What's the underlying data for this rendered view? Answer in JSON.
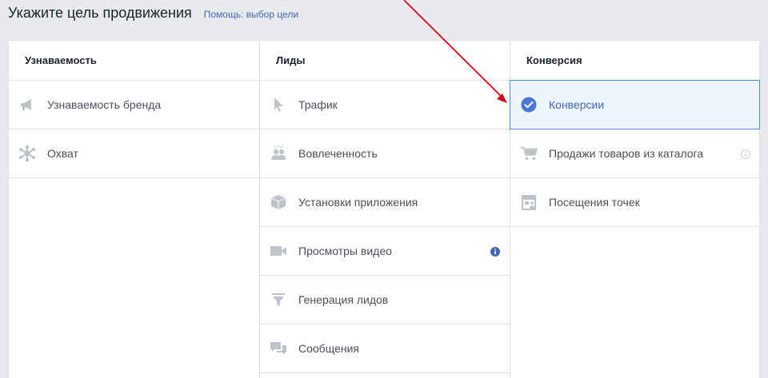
{
  "header": {
    "title": "Укажите цель продвижения",
    "help_link": "Помощь: выбор цели"
  },
  "columns": [
    {
      "heading": "Узнаваемость",
      "items": [
        {
          "label": "Узнаваемость бренда",
          "icon": "megaphone-icon"
        },
        {
          "label": "Охват",
          "icon": "reach-icon"
        }
      ]
    },
    {
      "heading": "Лиды",
      "items": [
        {
          "label": "Трафик",
          "icon": "cursor-icon"
        },
        {
          "label": "Вовлеченность",
          "icon": "people-icon"
        },
        {
          "label": "Установки приложения",
          "icon": "box-icon"
        },
        {
          "label": "Просмотры видео",
          "icon": "video-camera-icon",
          "info": true
        },
        {
          "label": "Генерация лидов",
          "icon": "funnel-icon"
        },
        {
          "label": "Сообщения",
          "icon": "chat-bubbles-icon"
        }
      ]
    },
    {
      "heading": "Конверсия",
      "items": [
        {
          "label": "Конверсии",
          "icon": "check-circle-icon",
          "selected": true
        },
        {
          "label": "Продажи товаров из каталога",
          "icon": "cart-icon",
          "info": true
        },
        {
          "label": "Посещения точек",
          "icon": "storefront-icon"
        }
      ]
    }
  ],
  "colors": {
    "background": "#e9eaed",
    "link": "#4267b2",
    "selected_border": "#4a90e2",
    "selected_bg": "#eef4fd",
    "icon_gray": "#bec3c9",
    "annotation_arrow": "#d0021b"
  }
}
